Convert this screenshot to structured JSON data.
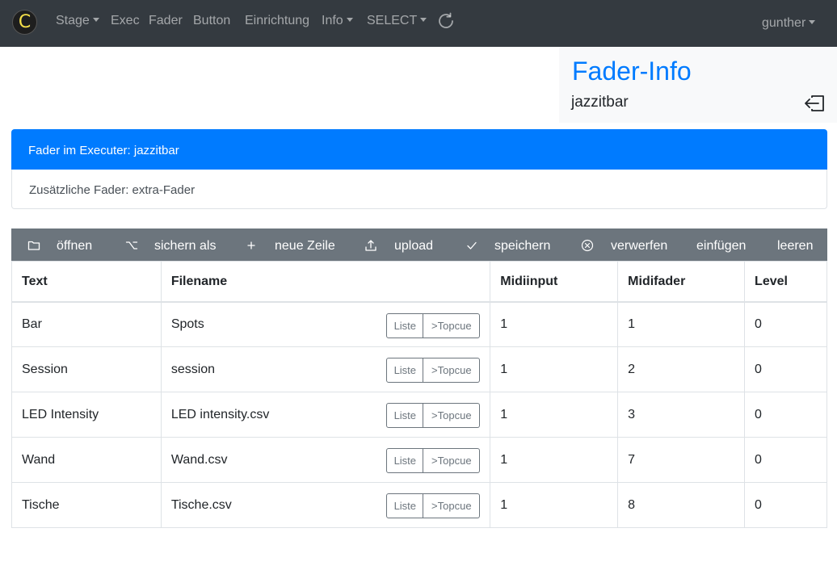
{
  "navbar": {
    "logo_letter": "C",
    "items": [
      {
        "label": "Stage",
        "dropdown": true
      },
      {
        "label": "Exec",
        "dropdown": false
      },
      {
        "label": "Fader",
        "dropdown": false
      },
      {
        "label": "Button",
        "dropdown": false
      },
      {
        "label": "Einrichtung",
        "dropdown": false
      },
      {
        "label": "Info",
        "dropdown": true
      },
      {
        "label": "SELECT",
        "dropdown": true
      }
    ],
    "user": "gunther"
  },
  "info_panel": {
    "title": "Fader-Info",
    "subtitle": "jazzitbar"
  },
  "list": {
    "active": "Fader im Executer: jazzitbar",
    "secondary": "Zusätzliche Fader: extra-Fader"
  },
  "toolbar": {
    "open": "öffnen",
    "save_as": "sichern als",
    "new_row": "neue Zeile",
    "upload": "upload",
    "save": "speichern",
    "discard": "verwerfen",
    "paste": "einfügen",
    "clear": "leeren"
  },
  "table": {
    "headers": [
      "Text",
      "Filename",
      "Midiinput",
      "Midifader",
      "Level"
    ],
    "button_list": "Liste",
    "button_topcue": ">Topcue",
    "rows": [
      {
        "text": "Bar",
        "filename": "Spots",
        "midiinput": "1",
        "midifader": "1",
        "level": "0"
      },
      {
        "text": "Session",
        "filename": "session",
        "midiinput": "1",
        "midifader": "2",
        "level": "0"
      },
      {
        "text": "LED Intensity",
        "filename": "LED intensity.csv",
        "midiinput": "1",
        "midifader": "3",
        "level": "0"
      },
      {
        "text": "Wand",
        "filename": "Wand.csv",
        "midiinput": "1",
        "midifader": "7",
        "level": "0"
      },
      {
        "text": "Tische",
        "filename": "Tische.csv",
        "midiinput": "1",
        "midifader": "8",
        "level": "0"
      }
    ]
  },
  "colors": {
    "navbar": "#343a40",
    "primary": "#007bff",
    "toolbar": "#6c757d",
    "logo_letter": "#f5e04a"
  }
}
